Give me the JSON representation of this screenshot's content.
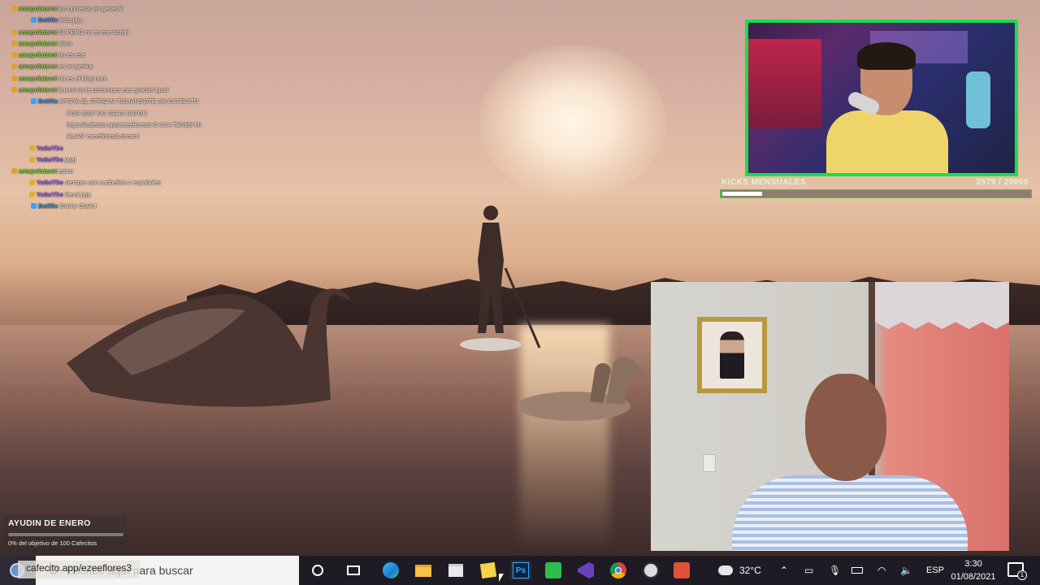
{
  "chat": {
    "messages": [
      {
        "user": "amapolatarot",
        "text": "los numeros en general",
        "color": "green",
        "indent": 0
      },
      {
        "user": "BotRix",
        "text": "hola jaja",
        "color": "blue",
        "indent": 1
      },
      {
        "user": "amapolatarot",
        "text": "SI PERO no es ese botori",
        "color": "green",
        "indent": 0
      },
      {
        "user": "amapolatarot",
        "text": "claro",
        "color": "green",
        "indent": 0
      },
      {
        "user": "amapolatarot",
        "text": "no es ese",
        "color": "green",
        "indent": 0
      },
      {
        "user": "amapolatarot",
        "text": "es un genius",
        "color": "green",
        "indent": 0
      },
      {
        "user": "amapolatarot",
        "text": "no es el blog num",
        "color": "green",
        "indent": 0
      },
      {
        "user": "amapolatarot",
        "text": "bueno no te preocupes eze gracias igual",
        "color": "green",
        "indent": 0
      },
      {
        "user": "BotRix",
        "text": "APOYA EL STREAM TOMANDOTE UN CAFECITO",
        "color": "blue",
        "indent": 1
      },
      {
        "user": "",
        "text": "POR 300P NO SEAS RATON",
        "color": "white",
        "indent": 2
      },
      {
        "user": "",
        "text": "https://cafecito.app/ezeeflores3 O ACA TENES MI",
        "color": "white",
        "indent": 2
      },
      {
        "user": "",
        "text": "ALIAS 'ezeeflores3.stream'",
        "color": "white",
        "indent": 2
      },
      {
        "user": "YoSoTfre",
        "text": "",
        "color": "purple",
        "indent": 3
      },
      {
        "user": "YoSoTfre",
        "text": "jajaj",
        "color": "purple",
        "indent": 3
      },
      {
        "user": "amapolatarot",
        "text": "epico",
        "color": "green",
        "indent": 0
      },
      {
        "user": "YoSoTfre",
        "text": "siempre son caribeños o españoles",
        "color": "purple",
        "indent": 3
      },
      {
        "user": "YoSoTfre",
        "text": "literal jaja",
        "color": "purple",
        "indent": 3
      },
      {
        "user": "BotRix",
        "text": "GUAU GUAU",
        "color": "blue",
        "indent": 1
      }
    ]
  },
  "kicks": {
    "label": "KICKS MENSUALES",
    "count": "2579",
    "goal": "20000",
    "progress": 0.129
  },
  "goal_widget": {
    "title": "AYUDIN DE ENERO",
    "subtitle": "0% del objetivo de 100 Cafecitos",
    "progress": 0
  },
  "taskbar": {
    "search_placeholder": "Escribe aquí para buscar",
    "overlay_url": "cafecito.app/ezeeflores3",
    "weather": "32°C",
    "language": "ESP",
    "time": "3:30",
    "date": "01/08/2021",
    "notification_count": "1"
  },
  "colors": {
    "accent_green": "#17e04c",
    "chat_green": "#8be04a",
    "chat_blue": "#3aa0ff",
    "chat_purple": "#a870ff"
  }
}
